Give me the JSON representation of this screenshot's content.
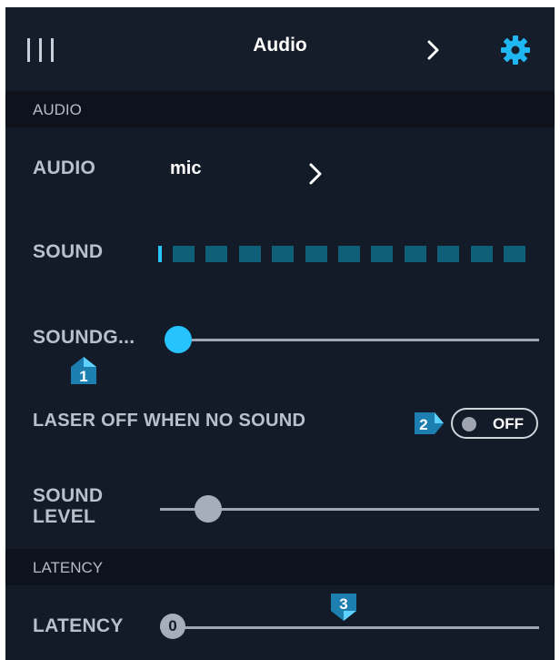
{
  "header": {
    "title": "Audio"
  },
  "sections": {
    "audio": "AUDIO",
    "latency": "LATENCY"
  },
  "audio_row": {
    "label": "AUDIO",
    "value": "mic"
  },
  "sound_row": {
    "label": "SOUND",
    "level_blocks": 11
  },
  "soundgate_row": {
    "label": "SOUNDG...",
    "value_fraction": 0.0
  },
  "laser_row": {
    "label": "LASER OFF WHEN NO SOUND",
    "toggle_state": "OFF"
  },
  "sound_level_row": {
    "label_line1": "SOUND",
    "label_line2": "LEVEL",
    "value_fraction": 0.13
  },
  "latency_row": {
    "label": "LATENCY",
    "value": "0",
    "value_fraction": 0.0
  },
  "markers": [
    "1",
    "2",
    "3"
  ],
  "colors": {
    "background": "#141b28",
    "accent": "#26c3ff",
    "section_bg": "#0d121c",
    "meter_block": "#0f5f78",
    "marker_fill": "#1d7fb0"
  },
  "icons": {
    "menu": "menu-icon",
    "header_next": "chevron-right-icon",
    "settings": "gear-icon",
    "row_next": "chevron-right-icon"
  }
}
